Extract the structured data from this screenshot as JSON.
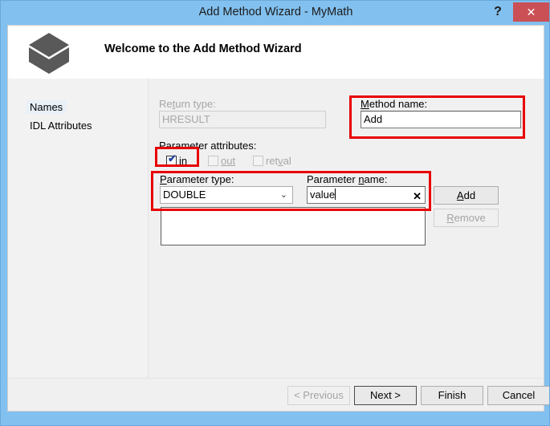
{
  "window": {
    "title": "Add Method Wizard - MyMath",
    "help_label": "?",
    "close_label": "✕",
    "titlebar_color": "#82c0ef",
    "close_color": "#cb5055",
    "annotation_color": "#e80000"
  },
  "header": {
    "welcome_title": "Welcome to the Add Method Wizard",
    "icon": "cube-icon"
  },
  "sidebar": {
    "items": [
      {
        "label": "Names",
        "selected": true
      },
      {
        "label": "IDL Attributes",
        "selected": false
      }
    ]
  },
  "form": {
    "return_type": {
      "label": "Return type:",
      "value": "HRESULT",
      "disabled": true
    },
    "method_name": {
      "label": "Method name:",
      "value": "Add",
      "placeholder": ""
    },
    "parameter_attributes": {
      "label": "Parameter attributes:",
      "options": [
        {
          "label": "in",
          "checked": true,
          "disabled": false,
          "mark": "✔"
        },
        {
          "label": "out",
          "checked": false,
          "disabled": true,
          "mark": ""
        },
        {
          "label": "retval",
          "checked": false,
          "disabled": true,
          "mark": ""
        }
      ]
    },
    "parameter_type": {
      "label": "Parameter type:",
      "value": "DOUBLE",
      "chevron": "⌄"
    },
    "parameter_name": {
      "label": "Parameter name:",
      "value": "value",
      "clear_label": "✕"
    },
    "add_button": {
      "label": "Add",
      "disabled": false
    },
    "remove_button": {
      "label": "Remove",
      "disabled": true
    },
    "parameter_list": {
      "items": []
    }
  },
  "footer": {
    "buttons": [
      {
        "label": "< Previous",
        "disabled": true,
        "default": false
      },
      {
        "label": "Next >",
        "disabled": false,
        "default": true
      },
      {
        "label": "Finish",
        "disabled": false,
        "default": false
      },
      {
        "label": "Cancel",
        "disabled": false,
        "default": false
      }
    ]
  }
}
